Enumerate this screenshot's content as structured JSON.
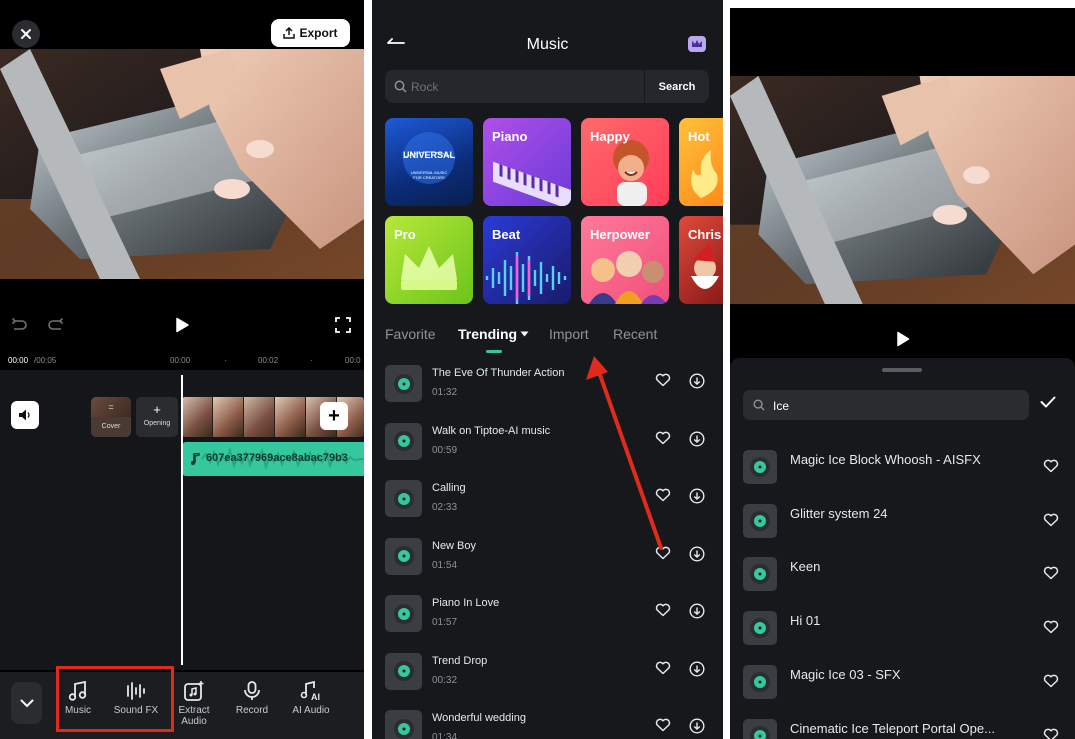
{
  "editor": {
    "export_label": "Export",
    "timecode_current": "00:00",
    "timecode_total": "/00:05",
    "ruler": [
      "00:00",
      "00:02",
      "00:0"
    ],
    "cover_label": "Cover",
    "opening_label": "Opening",
    "audio_clip_name": "607ea377969ace8abac79b3",
    "tools": [
      {
        "label": "Music",
        "icon": "music-note-icon"
      },
      {
        "label": "Sound FX",
        "icon": "sound-bars-icon"
      },
      {
        "label": "Extract Audio",
        "icon": "extract-audio-icon"
      },
      {
        "label": "Record",
        "icon": "microphone-icon"
      },
      {
        "label": "AI Audio",
        "icon": "ai-audio-icon"
      }
    ],
    "highlight_color": "#e02a1c"
  },
  "music": {
    "title": "Music",
    "search_placeholder": "Rock",
    "search_button": "Search",
    "categories": [
      {
        "label": "",
        "logo": "UNIVERSAL",
        "sub": "UNIVERSAL MUSIC FOR CREATORS"
      },
      {
        "label": "Piano"
      },
      {
        "label": "Happy"
      },
      {
        "label": "Hot"
      },
      {
        "label": "Pro"
      },
      {
        "label": "Beat"
      },
      {
        "label": "Herpower"
      },
      {
        "label": "Chris"
      }
    ],
    "tabs": [
      "Favorite",
      "Trending",
      "Import",
      "Recent"
    ],
    "active_tab": "Trending",
    "tracks": [
      {
        "name": "The Eve Of Thunder Action",
        "duration": "01:32"
      },
      {
        "name": "Walk on Tiptoe-AI music",
        "duration": "00:59"
      },
      {
        "name": "Calling",
        "duration": "02:33"
      },
      {
        "name": "New Boy",
        "duration": "01:54"
      },
      {
        "name": "Piano In Love",
        "duration": "01:57"
      },
      {
        "name": "Trend Drop",
        "duration": "00:32"
      },
      {
        "name": "Wonderful wedding",
        "duration": "01:34"
      }
    ],
    "accent_color": "#35c79e"
  },
  "sound_fx": {
    "search_value": "Ice",
    "results": [
      {
        "name": "Magic Ice Block Whoosh - AISFX"
      },
      {
        "name": "Glitter system 24"
      },
      {
        "name": "Keen"
      },
      {
        "name": "Hi 01"
      },
      {
        "name": "Magic Ice 03 - SFX"
      },
      {
        "name": "Cinematic Ice Teleport Portal Ope..."
      }
    ]
  }
}
